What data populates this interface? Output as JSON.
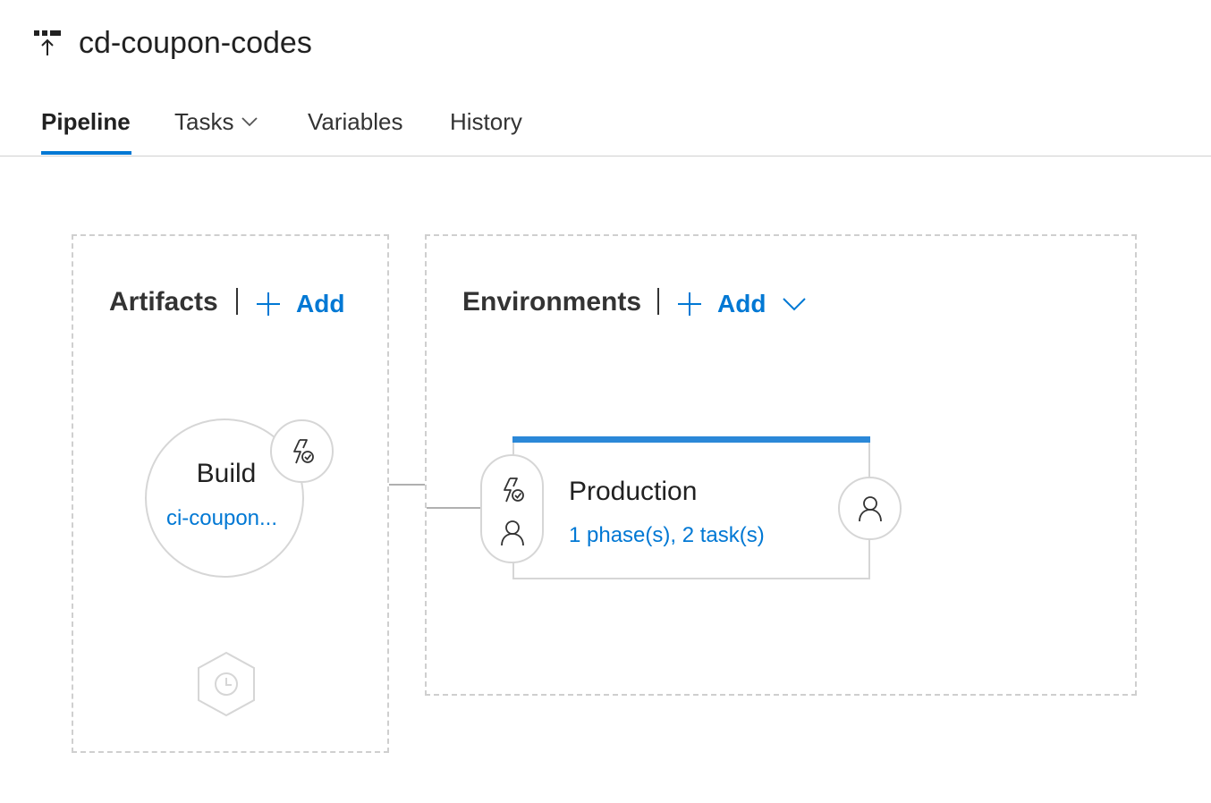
{
  "header": {
    "title": "cd-coupon-codes",
    "icon": "release-pipeline-icon"
  },
  "tabs": [
    {
      "label": "Pipeline",
      "active": true
    },
    {
      "label": "Tasks",
      "has_dropdown": true
    },
    {
      "label": "Variables"
    },
    {
      "label": "History"
    }
  ],
  "artifacts": {
    "title": "Artifacts",
    "add_label": "Add",
    "build": {
      "title": "Build",
      "source": "ci-coupon..."
    }
  },
  "environments": {
    "title": "Environments",
    "add_label": "Add",
    "items": [
      {
        "name": "Production",
        "summary": "1 phase(s), 2 task(s)"
      }
    ]
  },
  "colors": {
    "accent": "#0078d4",
    "env_bar": "#2b88d8",
    "border": "#d6d6d6"
  }
}
